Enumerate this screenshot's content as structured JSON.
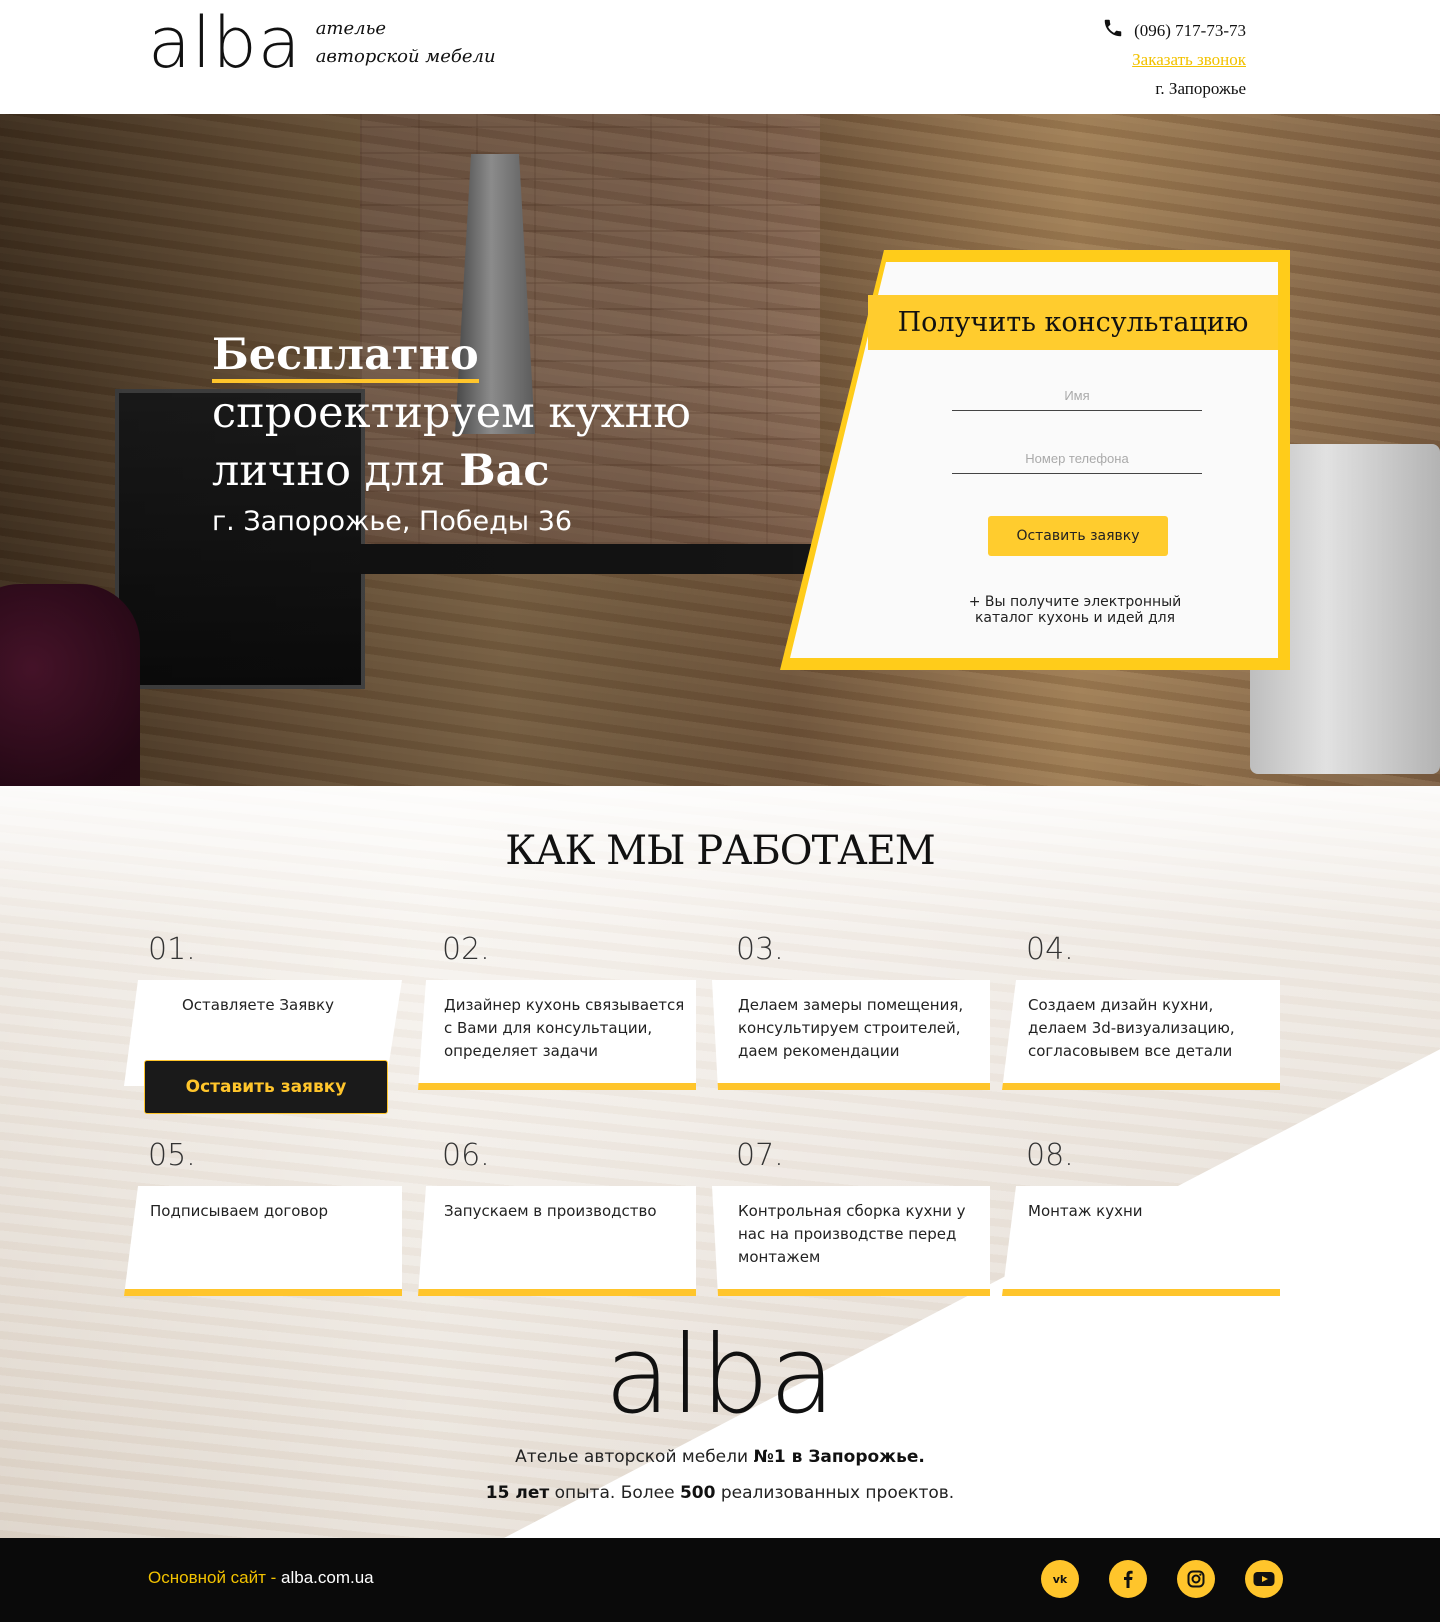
{
  "header": {
    "logo": "alba",
    "tagline_line1": "ателье",
    "tagline_line2": "авторской мебели",
    "phone": "(096) 717-73-73",
    "callback_link": "Заказать звонок",
    "city": "г. Запорожье"
  },
  "hero": {
    "line1_bold": "Бесплатно",
    "line2": "спроектируем кухню",
    "line3_prefix": "лично для ",
    "line3_bold": "Вас",
    "address": "г. Запорожье, Победы 36"
  },
  "form": {
    "title": "Получить консультацию",
    "name_placeholder": "Имя",
    "phone_placeholder": "Номер телефона",
    "submit_label": "Оставить заявку",
    "note_line1": "+ Вы получите электронный",
    "note_line2": "каталог кухонь и идей для"
  },
  "how_we_work": {
    "title": "КАК МЫ РАБОТАЕМ",
    "cta_label": "Оставить заявку",
    "steps": [
      {
        "num": "01.",
        "text": "Оставляете Заявку"
      },
      {
        "num": "02.",
        "text": "Дизайнер кухонь связывается с Вами для консультации, определяет задачи"
      },
      {
        "num": "03.",
        "text": "Делаем замеры помещения, консультируем строителей, даем рекомендации"
      },
      {
        "num": "04.",
        "text": "Создаем дизайн кухни, делаем 3d-визуализацию, согласовывем все детали"
      },
      {
        "num": "05.",
        "text": "Подписываем договор"
      },
      {
        "num": "06.",
        "text": "Запускаем в производство"
      },
      {
        "num": "07.",
        "text": "Контрольная сборка кухни у нас на производстве перед монтажем"
      },
      {
        "num": "08.",
        "text": "Монтаж кухни"
      }
    ]
  },
  "brand": {
    "logo": "alba",
    "line1_prefix": "Ателье авторской мебели ",
    "line1_bold": "№1 в Запорожье.",
    "line2_bold1": "15 лет",
    "line2_mid": " опыта. Более ",
    "line2_bold2": "500",
    "line2_suffix": " реализованных проектов."
  },
  "footer": {
    "label": "Основной сайт - ",
    "url": "alba.com.ua",
    "social_icons": [
      "vk-icon",
      "facebook-icon",
      "instagram-icon",
      "youtube-icon"
    ]
  },
  "colors": {
    "accent": "#ffc52b",
    "footer_bg": "#0a0a0a"
  }
}
